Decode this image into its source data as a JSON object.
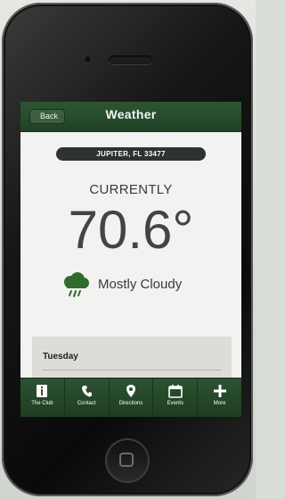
{
  "navbar": {
    "back_label": "Back",
    "title": "Weather"
  },
  "weather": {
    "location": "JUPITER, FL 33477",
    "currently_label": "CURRENTLY",
    "temperature": "70.6°",
    "condition": "Mostly Cloudy",
    "condition_icon": "cloud-rain-icon"
  },
  "forecast": {
    "day": "Tuesday"
  },
  "tabs": [
    {
      "label": "The Club",
      "icon": "info-icon"
    },
    {
      "label": "Contact",
      "icon": "phone-icon"
    },
    {
      "label": "Directions",
      "icon": "map-pin-icon"
    },
    {
      "label": "Events",
      "icon": "calendar-icon"
    },
    {
      "label": "More",
      "icon": "plus-icon"
    }
  ],
  "colors": {
    "nav_green": "#2f5535",
    "tab_green": "#2d5231",
    "screen_bg": "#f2f2f0"
  }
}
